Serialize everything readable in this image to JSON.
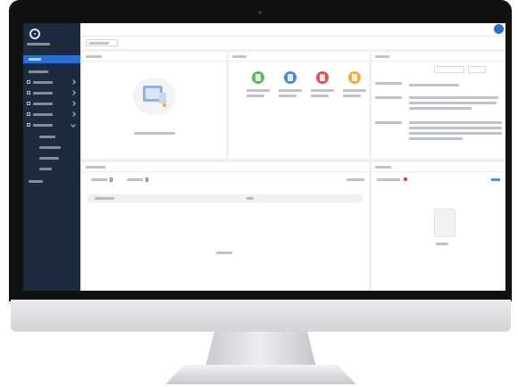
{
  "theme": {
    "sidebar_bg": "#1c2b3d",
    "accent": "#2b6fd6",
    "content_bg": "#eef0f4",
    "badge_color": "#e0322f"
  },
  "sidebar": {
    "logo_icon": "logo-icon",
    "items": [
      {
        "icon": "home-icon"
      },
      {
        "icon": "grid-icon"
      },
      {
        "icon": "doc-icon"
      },
      {
        "icon": "folder-icon"
      },
      {
        "icon": "chart-icon"
      },
      {
        "icon": "settings-icon"
      }
    ]
  },
  "quick_actions": {
    "colors": [
      "#5cb85c",
      "#4a86d6",
      "#e0534f",
      "#f0ad3a"
    ],
    "icons": [
      "doc-icon",
      "doc-icon",
      "doc-icon",
      "doc-icon"
    ]
  },
  "header": {
    "avatar_icon": "avatar-icon"
  }
}
